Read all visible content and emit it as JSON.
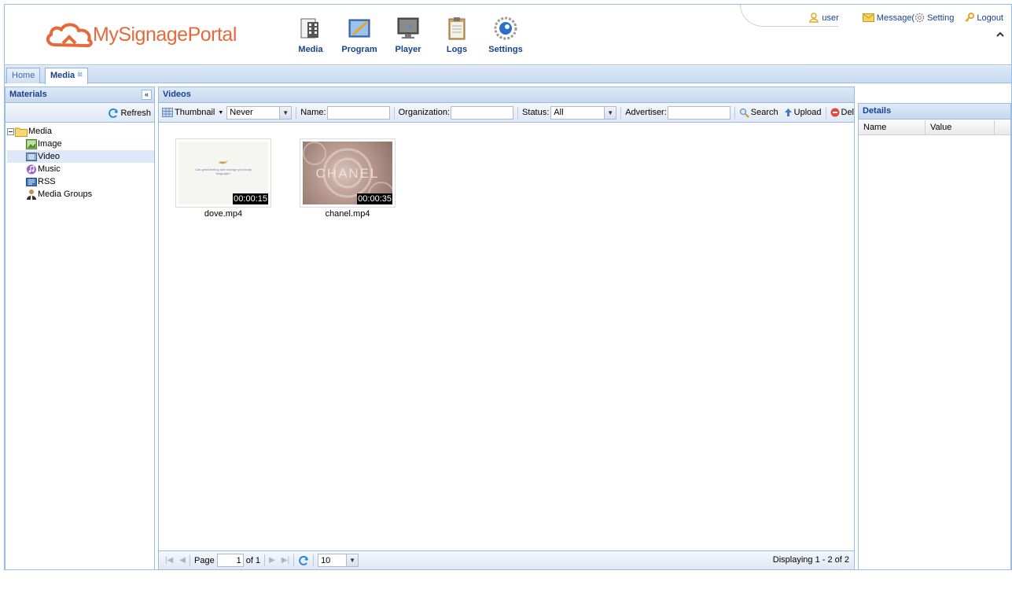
{
  "brand": {
    "part1": "MySignage",
    "part2": "Portal"
  },
  "nav": [
    {
      "label": "Media",
      "icon": "media-icon"
    },
    {
      "label": "Program",
      "icon": "program-icon"
    },
    {
      "label": "Player",
      "icon": "player-icon"
    },
    {
      "label": "Logs",
      "icon": "logs-icon"
    },
    {
      "label": "Settings",
      "icon": "settings-icon"
    }
  ],
  "user": {
    "name": "user",
    "message": "Message(",
    "setting": "Setting",
    "logout": "Logout"
  },
  "tabs": [
    {
      "label": "Home"
    },
    {
      "label": "Media",
      "close": "⊠"
    }
  ],
  "materials": {
    "title": "Materials",
    "refresh": "Refresh",
    "tree": [
      {
        "label": "Media",
        "icon": "folder-icon",
        "level": 0
      },
      {
        "label": "Image",
        "icon": "image-icon",
        "level": 1
      },
      {
        "label": "Video",
        "icon": "video-icon",
        "level": 1,
        "selected": true
      },
      {
        "label": "Music",
        "icon": "music-icon",
        "level": 1
      },
      {
        "label": "RSS",
        "icon": "rss-icon",
        "level": 1
      },
      {
        "label": "Media Groups",
        "icon": "media-groups-icon",
        "level": 1
      }
    ]
  },
  "videos": {
    "title": "Videos",
    "toolbar": {
      "view": "Thumbnail",
      "period": "Never",
      "name_label": "Name:",
      "name_value": "",
      "org_label": "Organization:",
      "org_value": "",
      "status_label": "Status:",
      "status_value": "All",
      "adv_label": "Advertiser:",
      "adv_value": "",
      "search": "Search",
      "upload": "Upload",
      "delete": "Del"
    },
    "items": [
      {
        "name": "dove.mp4",
        "duration": "00:00:15",
        "caption": "Can great feeling skin change your body language?"
      },
      {
        "name": "chanel.mp4",
        "duration": "00:00:35",
        "caption": "CHANEL"
      }
    ],
    "pager": {
      "page_label": "Page",
      "page": "1",
      "of": "of 1",
      "page_size": "10",
      "display": "Displaying 1 - 2 of 2"
    }
  },
  "details": {
    "title": "Details",
    "col_name": "Name",
    "col_value": "Value"
  },
  "colors": {
    "accent": "#15428b",
    "border": "#99bbe8",
    "brand": "#e46a3c"
  }
}
